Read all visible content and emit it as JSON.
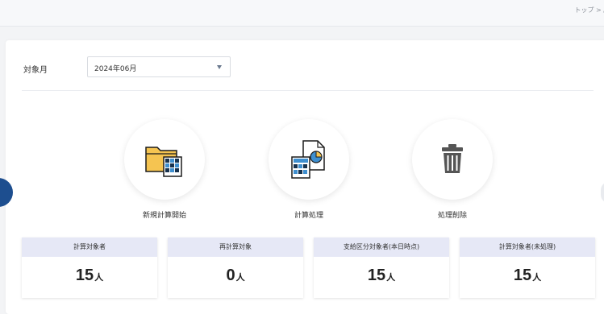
{
  "breadcrumb": {
    "text": "トップ > /"
  },
  "filter": {
    "month_label": "対象月",
    "month_value": "2024年06月"
  },
  "actions": [
    {
      "label": "新規計算開始",
      "icon": "folder-spreadsheet-icon"
    },
    {
      "label": "計算処理",
      "icon": "document-chart-calculator-icon"
    },
    {
      "label": "処理削除",
      "icon": "trash-icon"
    }
  ],
  "cards": [
    {
      "title": "計算対象者",
      "value": "15",
      "unit": "人"
    },
    {
      "title": "再計算対象",
      "value": "0",
      "unit": "人"
    },
    {
      "title": "支給区分対象者(本日時点)",
      "value": "15",
      "unit": "人"
    },
    {
      "title": "計算対象者(未処理)",
      "value": "15",
      "unit": "人"
    }
  ],
  "colors": {
    "accent": "#1d4e8f",
    "card_header": "#e6e8f6",
    "folder": "#f5c451",
    "sheet_blue": "#3f8fcf",
    "sheet_dark": "#16324f"
  }
}
